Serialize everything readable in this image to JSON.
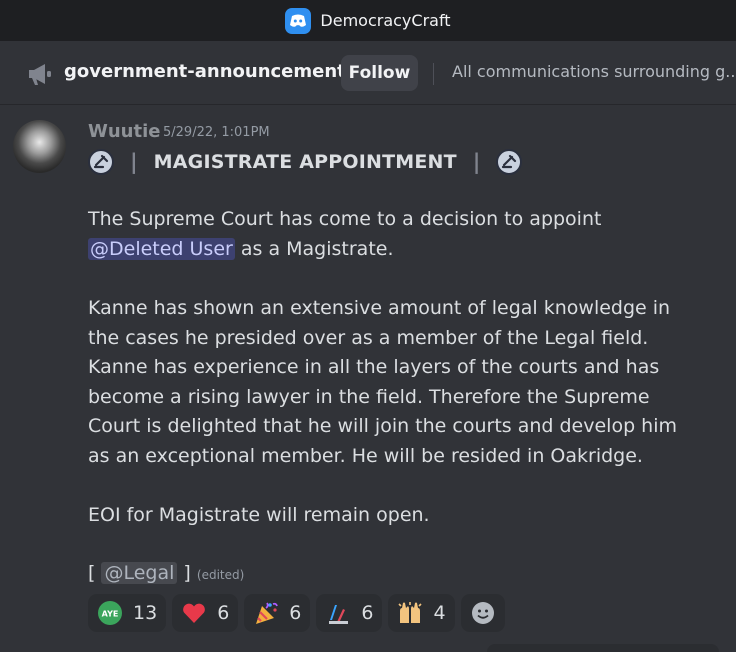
{
  "app": {
    "title": "DemocracyCraft",
    "icon": "discord-app-icon"
  },
  "channel": {
    "name": "government-announcements",
    "follow_label": "Follow",
    "topic": "All communications surrounding g..."
  },
  "message": {
    "author": "Wuutie",
    "timestamp": "5/29/22, 1:01PM",
    "headline": "MAGISTRATE APPOINTMENT",
    "separator": "|",
    "para1": {
      "before": "The Supreme Court has come to a decision to appoint ",
      "mention": "@Deleted User",
      "after": " as a Magistrate."
    },
    "para2": "Kanne has shown an extensive amount of legal knowledge in the cases he presided over as a member of the Legal field. Kanne has experience in all the layers of the courts and has become a rising lawyer in the field. Therefore the Supreme Court is delighted that he will join the courts and develop him as an exceptional member. He will be resided in Oakridge.",
    "para3": "EOI for Magistrate will remain open.",
    "footer": {
      "open": "[ ",
      "role": "@Legal",
      "close": " ]",
      "edited": "(edited)"
    }
  },
  "reactions": [
    {
      "name": "aye",
      "count": "13"
    },
    {
      "name": "red-heart",
      "count": "6"
    },
    {
      "name": "party-popper",
      "count": "6"
    },
    {
      "name": "scales",
      "count": "6"
    },
    {
      "name": "raised-hands",
      "count": "4"
    }
  ],
  "colors": {
    "mention_bg": "#3c4270",
    "accent": "#5865f2",
    "background": "#313338"
  }
}
